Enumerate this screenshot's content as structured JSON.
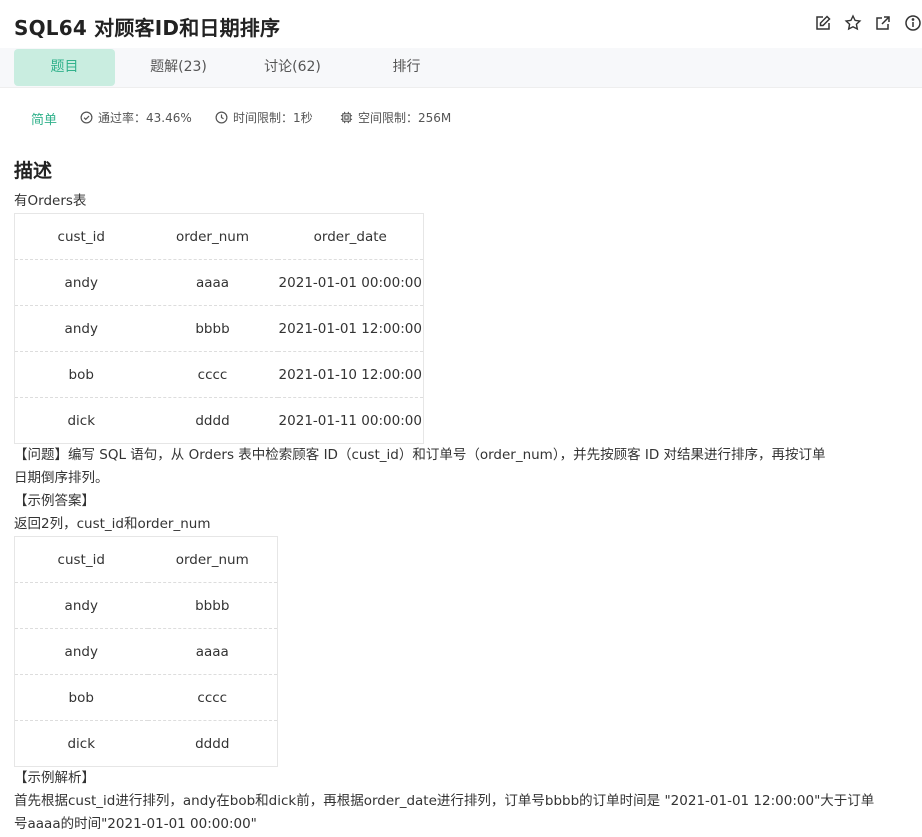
{
  "header": {
    "title": "SQL64  对顾客ID和日期排序",
    "icons": [
      "edit-icon",
      "star-icon",
      "share-icon",
      "info-icon"
    ]
  },
  "tabs": [
    {
      "label": "题目",
      "active": true
    },
    {
      "label": "题解(23)",
      "active": false
    },
    {
      "label": "讨论(62)",
      "active": false
    },
    {
      "label": "排行",
      "active": false
    }
  ],
  "meta": {
    "difficulty": "简单",
    "pass_rate": "通过率：43.46%",
    "time_limit": "时间限制：1秒",
    "space_limit": "空间限制：256M"
  },
  "description": {
    "heading": "描述",
    "intro": "有Orders表",
    "orders_table": {
      "headers": [
        "cust_id",
        "order_num",
        "order_date"
      ],
      "rows": [
        [
          "andy",
          "aaaa",
          "2021-01-01 00:00:00"
        ],
        [
          "andy",
          "bbbb",
          "2021-01-01 12:00:00"
        ],
        [
          "bob",
          "cccc",
          "2021-01-10 12:00:00"
        ],
        [
          "dick",
          "dddd",
          "2021-01-11 00:00:00"
        ]
      ]
    },
    "question_line1": "【问题】编写 SQL 语句，从 Orders 表中检索顾客 ID（cust_id）和订单号（order_num），并先按顾客 ID 对结果进行排序，再按订单",
    "question_line2": "日期倒序排列。",
    "example_heading": "【示例答案】",
    "example_intro": "返回2列，cust_id和order_num",
    "answer_table": {
      "headers": [
        "cust_id",
        "order_num"
      ],
      "rows": [
        [
          "andy",
          "bbbb"
        ],
        [
          "andy",
          "aaaa"
        ],
        [
          "bob",
          "cccc"
        ],
        [
          "dick",
          "dddd"
        ]
      ]
    },
    "analysis_heading": "【示例解析】",
    "analysis_line1": "首先根据cust_id进行排列，andy在bob和dick前，再根据order_date进行排列，订单号bbbb的订单时间是 \"2021-01-01 12:00:00\"大于订单",
    "analysis_line2": "号aaaa的时间\"2021-01-01 00:00:00\""
  },
  "colors": {
    "accent": "#32b28c",
    "active_tab_bg": "#c9ede0"
  }
}
